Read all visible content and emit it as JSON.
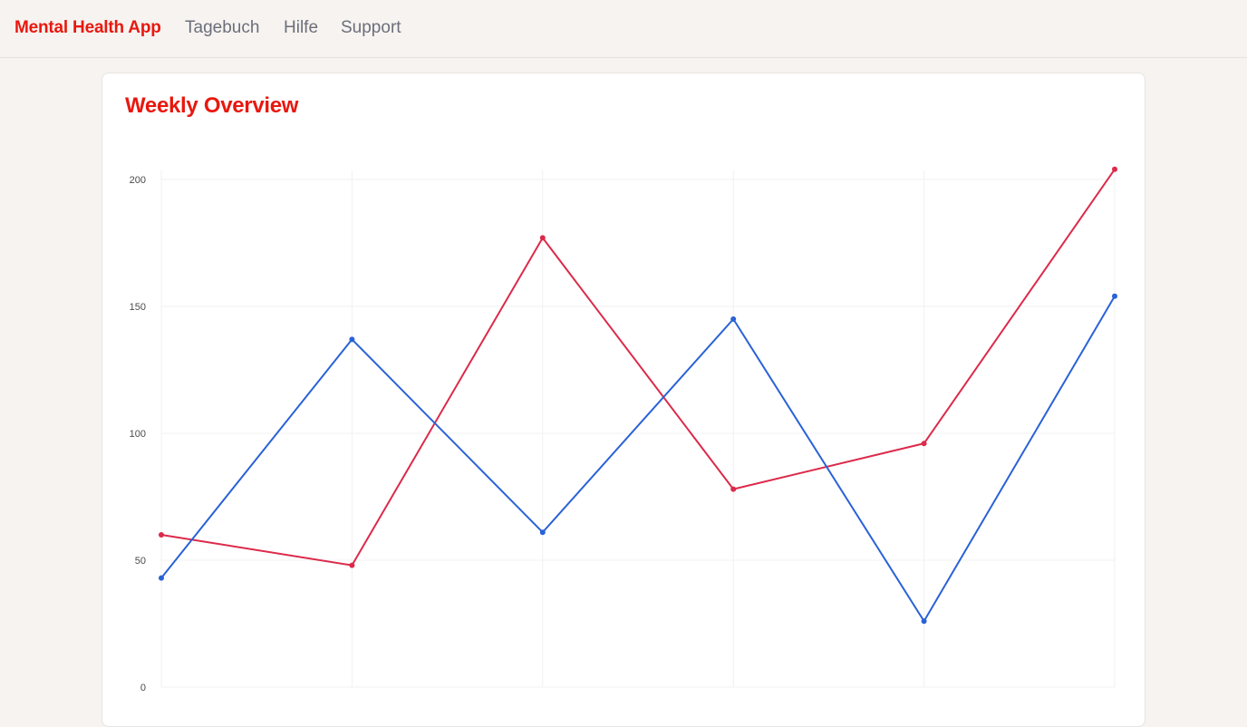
{
  "app": {
    "brand": "Mental Health App",
    "nav": [
      "Tagebuch",
      "Hilfe",
      "Support"
    ],
    "brand_color": "#e8180f"
  },
  "card": {
    "title": "Weekly Overview"
  },
  "chart_data": {
    "type": "line",
    "title": "Weekly Overview",
    "xlabel": "",
    "ylabel": "",
    "ylim": [
      0,
      200
    ],
    "yticks": [
      0,
      50,
      100,
      150,
      200
    ],
    "x": [
      0,
      1,
      2,
      3,
      4,
      5
    ],
    "grid": true,
    "series": [
      {
        "color": "#dc2a4a",
        "values": [
          60,
          48,
          177,
          78,
          96,
          204
        ]
      },
      {
        "color": "#2a62d6",
        "values": [
          43,
          137,
          61,
          145,
          26,
          154
        ]
      }
    ]
  }
}
